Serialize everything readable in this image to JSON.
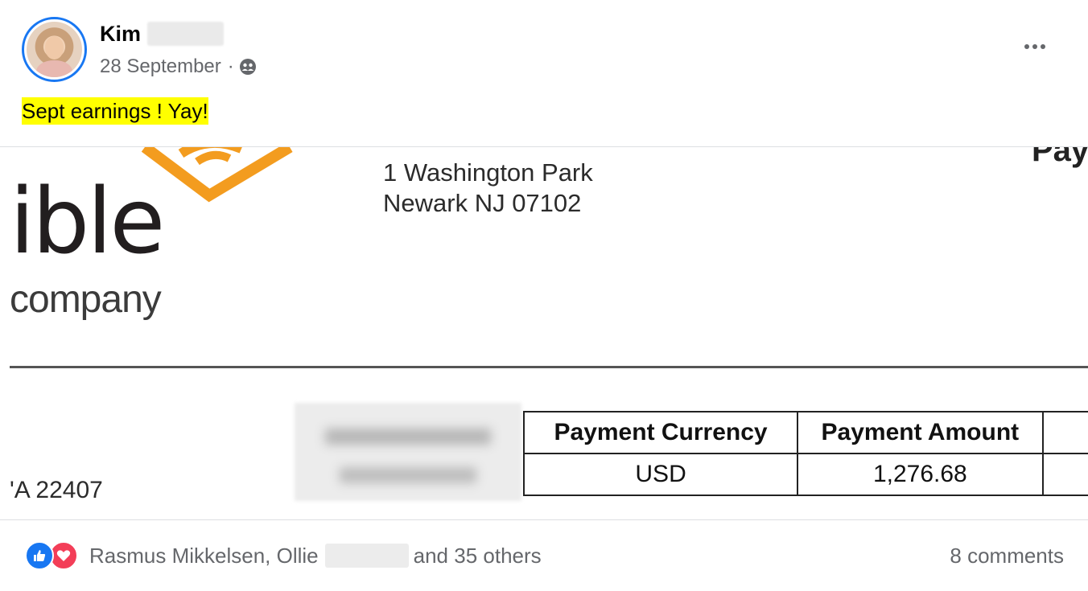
{
  "post": {
    "author": "Kim",
    "date": "28 September",
    "separator": "·",
    "audience_icon": "friends-icon",
    "text": "Sept earnings !  Yay!",
    "highlight_color": "#ffff00"
  },
  "attachment": {
    "logo_text": "ible",
    "logo_sub": "company",
    "address_line1": "1 Washington Park",
    "address_line2": "Newark  NJ  07102",
    "corner_text": "Pay",
    "zip_text": "'A  22407",
    "logo_color": "#f39c1f",
    "table": {
      "headers": [
        "Payment Currency",
        "Payment Amount"
      ],
      "rows": [
        [
          "USD",
          "1,276.68"
        ]
      ]
    }
  },
  "reactions": {
    "types": [
      "like",
      "love"
    ],
    "names_prefix": "Rasmus Mikkelsen, Ollie",
    "names_suffix": "and 35 others"
  },
  "comments": {
    "label": "8 comments"
  }
}
